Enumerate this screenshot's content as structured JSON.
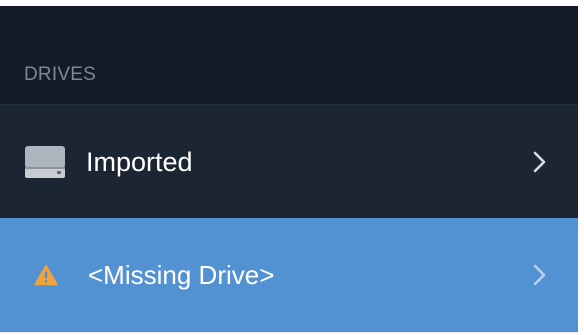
{
  "sidebar": {
    "section_title": "DRIVES",
    "items": [
      {
        "label": "Imported",
        "icon": "hard-drive-icon",
        "selected": false
      },
      {
        "label": "<Missing Drive>",
        "icon": "warning-icon",
        "selected": true
      }
    ]
  },
  "colors": {
    "background": "#1b2532",
    "header_band": "#141b26",
    "selected_row": "#5392d2",
    "section_label": "#7d8896",
    "warning": "#f0a33c",
    "text": "#ffffff"
  }
}
